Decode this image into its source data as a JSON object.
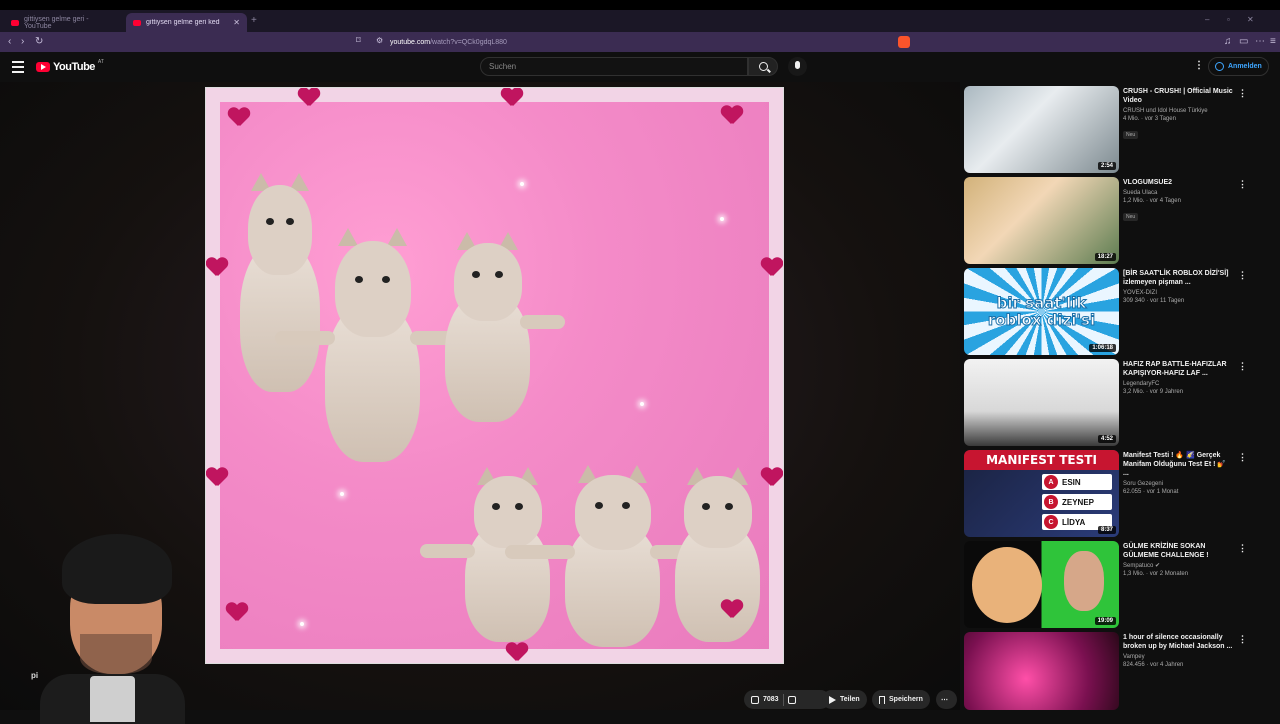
{
  "browser": {
    "tabs": [
      {
        "title": "gittiysen gelme geri - YouTube",
        "active": false
      },
      {
        "title": "gittiysen gelme geri kedi - YouTu",
        "active": true
      }
    ],
    "url_host": "youtube.com",
    "url_path": "/watch?v=QCk0gdqL880"
  },
  "header": {
    "logo_text": "YouTube",
    "country_code": "AT",
    "search_placeholder": "Suchen",
    "signin_label": "Anmelden"
  },
  "player": {
    "overlay_text": "pi"
  },
  "actions": {
    "like_count": "7083",
    "share_label": "Teilen",
    "save_label": "Speichern"
  },
  "recommendations": [
    {
      "title": "CRUSH - CRUSH! | Official Music Video",
      "channel": "CRUSH und Idol House Türkiye",
      "views": "4 Mio.",
      "age": "vor 3 Tagen",
      "badge": "Neu",
      "duration": "2:54"
    },
    {
      "title": "VLOGUMSUE2",
      "channel": "Sueda Ulaca",
      "views": "1,2 Mio.",
      "age": "vor 4 Tagen",
      "badge": "Neu",
      "duration": "18:27"
    },
    {
      "title": "[BİR SAAT'LİK ROBLOX DİZİ'Sİ] izlemeyen pişman ...",
      "channel": "YOVEX-DIZI",
      "views": "309 340",
      "age": "vor 11 Tagen",
      "badge": "",
      "duration": "1:06:18",
      "thumb_text": "bir saat'lik roblox dizi'si"
    },
    {
      "title": "HAFIZ RAP BATTLE-HAFIZLAR KAPIŞIYOR-HAFIZ LAF ...",
      "channel": "LegendaryFC",
      "views": "3,2 Mio.",
      "age": "vor 9 Jahren",
      "badge": "",
      "duration": "4:52"
    },
    {
      "title": "Manifest Testi ! 🔥 🌠 Gerçek Manifam Olduğunu Test Et ! 💅 ...",
      "channel": "Soru Gezegeni",
      "views": "62.055",
      "age": "vor 1 Monat",
      "badge": "",
      "duration": "8:37",
      "thumb_title": "MANIFEST TESTI",
      "options": [
        {
          "letter": "A",
          "name": "ESIN"
        },
        {
          "letter": "B",
          "name": "ZEYNEP"
        },
        {
          "letter": "C",
          "name": "LİDYA"
        }
      ]
    },
    {
      "title": "GÜLME KRİZİNE SOKAN GÜLMEME CHALLENGE !",
      "channel": "Sempatuco",
      "views": "1,3 Mio.",
      "age": "vor 2 Monaten",
      "badge": "",
      "duration": "19:09"
    },
    {
      "title": "1 hour of silence occasionally broken up by Michael Jackson ...",
      "channel": "Vampey",
      "views": "824.456",
      "age": "vor 4 Jahren",
      "badge": "",
      "duration": ""
    }
  ],
  "colors": {
    "browser_tabstrip": "#1b1726",
    "browser_toolbar": "#3b2c52",
    "youtube_red": "#ff0033",
    "link_blue": "#3ea6ff",
    "page_bg": "#0f0f0f"
  }
}
